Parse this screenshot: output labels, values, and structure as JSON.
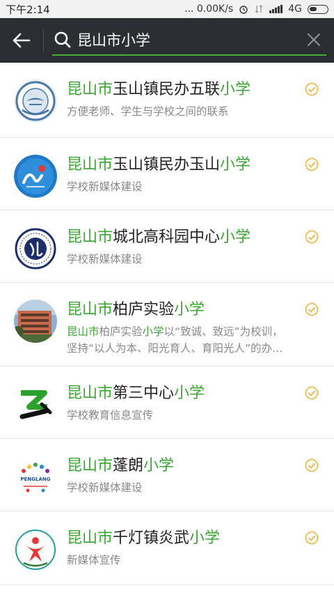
{
  "status_bar": {
    "time": "下午2:14",
    "network_speed": "... 0.00K/s",
    "network_type": "4G"
  },
  "search": {
    "query": "昆山市小学"
  },
  "colors": {
    "accent_green": "#3aa631",
    "topbar": "#2b2f33",
    "verified_badge": "#f0b43a"
  },
  "results": [
    {
      "pre": "昆山市",
      "mid": "玉山镇民办五联",
      "post": "小学",
      "desc_pre": "",
      "desc_hl": "",
      "desc_mid": "方便老师、学生与学校之间的联系",
      "desc_hl2": "",
      "desc_post": "",
      "avatar_icon": "school-emblem-wulian"
    },
    {
      "pre": "昆山市",
      "mid": "玉山镇民办玉山",
      "post": "小学",
      "desc_pre": "",
      "desc_hl": "",
      "desc_mid": "学校新媒体建设",
      "desc_hl2": "",
      "desc_post": "",
      "avatar_icon": "school-logo-yushan"
    },
    {
      "pre": "昆山市",
      "mid": "城北高科园中心",
      "post": "小学",
      "desc_pre": "",
      "desc_hl": "",
      "desc_mid": "学校新媒体建设",
      "desc_hl2": "",
      "desc_post": "",
      "avatar_icon": "school-emblem-chengbei"
    },
    {
      "pre": "昆山市",
      "mid": "柏庐实验",
      "post": "小学",
      "desc_pre": "",
      "desc_hl": "昆山市",
      "desc_mid": "柏庐实验",
      "desc_hl2": "小学",
      "desc_post": "以“致诚、致远”为校训，坚持“以人为本、阳光育人、育阳光人”的办学理...",
      "avatar_icon": "school-building-photo"
    },
    {
      "pre": "昆山市",
      "mid": "第三中心",
      "post": "小学",
      "desc_pre": "",
      "desc_hl": "",
      "desc_mid": "学校教育信息宣传",
      "desc_hl2": "",
      "desc_post": "",
      "avatar_icon": "school-logo-disan"
    },
    {
      "pre": "昆山市",
      "mid": "蓬朗",
      "post": "小学",
      "desc_pre": "",
      "desc_hl": "",
      "desc_mid": "学校新媒体建设",
      "desc_hl2": "",
      "desc_post": "",
      "avatar_icon": "school-logo-penglang"
    },
    {
      "pre": "昆山市",
      "mid": "千灯镇炎武",
      "post": "小学",
      "desc_pre": "",
      "desc_hl": "",
      "desc_mid": "新媒体宣传",
      "desc_hl2": "",
      "desc_post": "",
      "avatar_icon": "school-emblem-yanwu"
    }
  ],
  "avatar_logo_text": {
    "penglang": "PENGLANG"
  }
}
